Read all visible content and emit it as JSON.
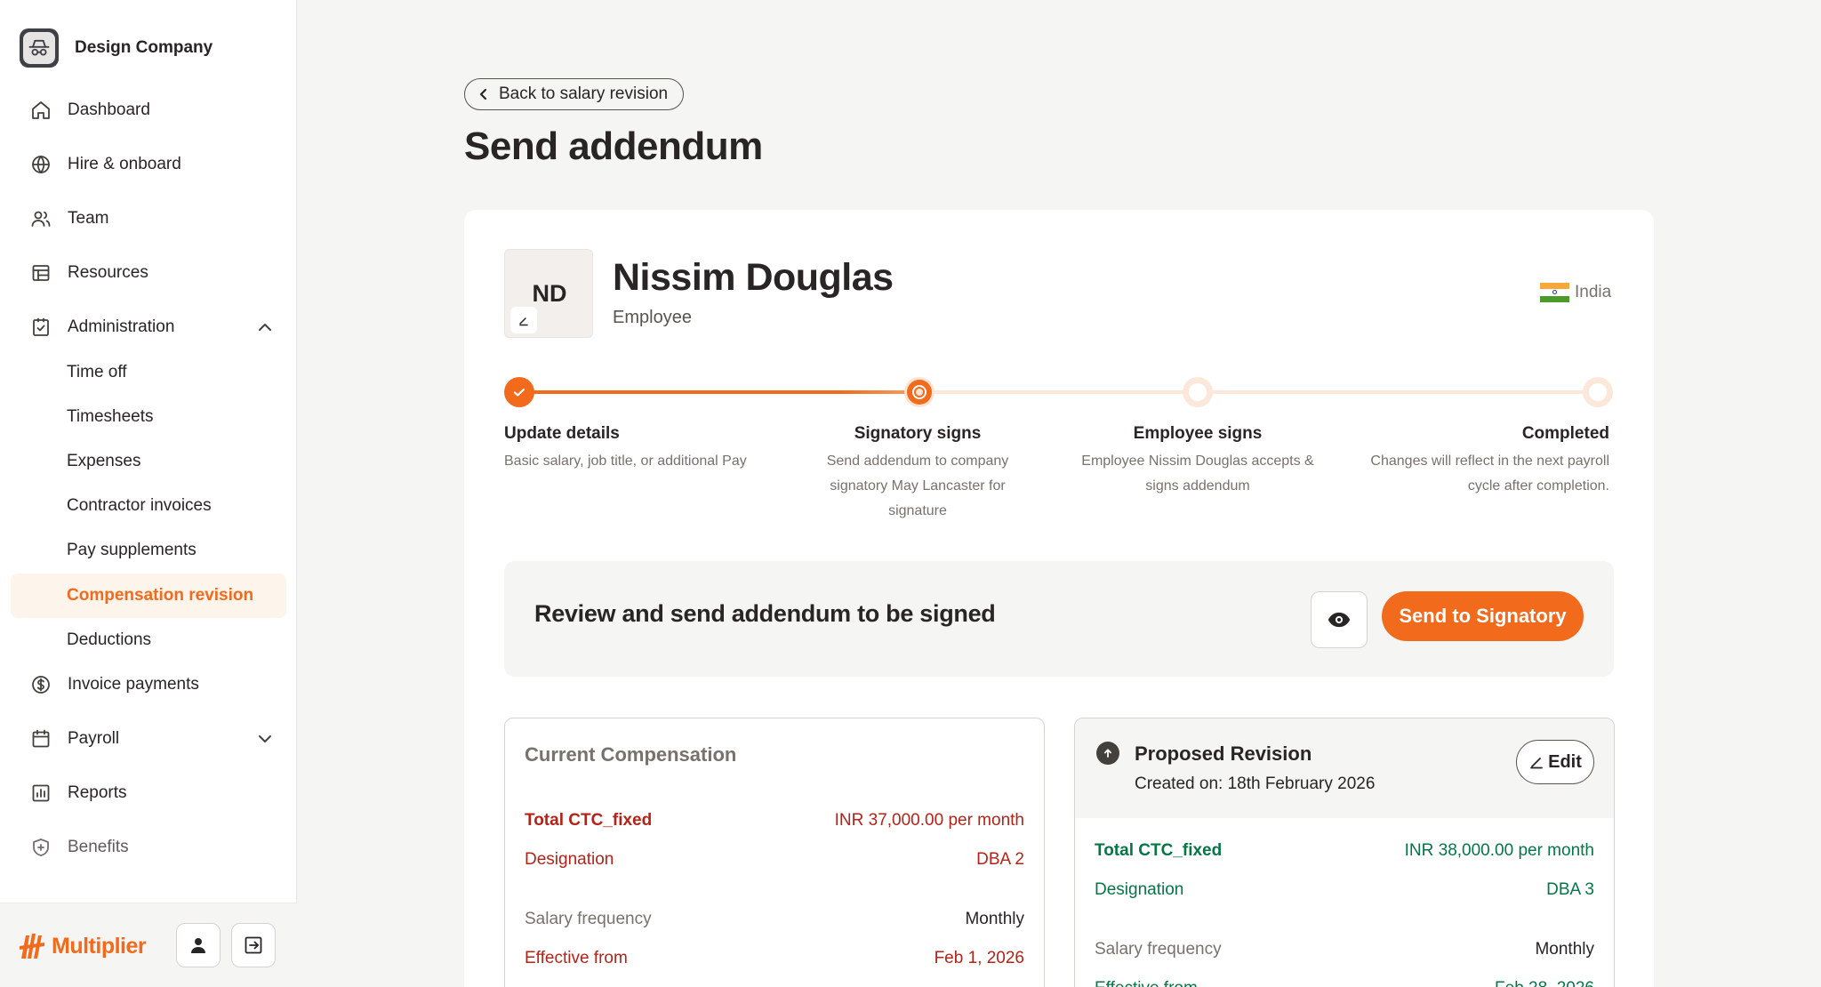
{
  "company": {
    "name": "Design Company"
  },
  "sidebar": {
    "items": [
      {
        "label": "Dashboard"
      },
      {
        "label": "Hire & onboard"
      },
      {
        "label": "Team"
      },
      {
        "label": "Resources"
      },
      {
        "label": "Administration"
      },
      {
        "label": "Invoice payments"
      },
      {
        "label": "Payroll"
      },
      {
        "label": "Reports"
      },
      {
        "label": "Benefits"
      }
    ],
    "admin_sub": [
      {
        "label": "Time off"
      },
      {
        "label": "Timesheets"
      },
      {
        "label": "Expenses"
      },
      {
        "label": "Contractor invoices"
      },
      {
        "label": "Pay supplements"
      },
      {
        "label": "Compensation revision"
      },
      {
        "label": "Deductions"
      }
    ],
    "footer": {
      "brand": "Multiplier"
    }
  },
  "header": {
    "back_label": "Back to salary revision",
    "title": "Send addendum"
  },
  "employee": {
    "initials": "ND",
    "name": "Nissim Douglas",
    "role": "Employee",
    "country": "India"
  },
  "stepper": {
    "steps": [
      {
        "title": "Update details",
        "desc": "Basic salary, job title, or additional Pay",
        "status": "complete"
      },
      {
        "title": "Signatory signs",
        "desc": "Send addendum to company signatory May Lancaster for signature",
        "status": "current"
      },
      {
        "title": "Employee signs",
        "desc": "Employee Nissim Douglas accepts & signs addendum",
        "status": "pending"
      },
      {
        "title": "Completed",
        "desc": "Changes will reflect in the next payroll cycle after completion.",
        "status": "pending"
      }
    ]
  },
  "review": {
    "text": "Review and send addendum to be signed",
    "send_label": "Send to Signatory"
  },
  "current": {
    "title": "Current Compensation",
    "rows": [
      {
        "label": "Total CTC_fixed",
        "value": "INR 37,000.00 per month"
      },
      {
        "label": "Designation",
        "value": "DBA 2"
      },
      {
        "label": "Salary frequency",
        "value": "Monthly"
      },
      {
        "label": "Effective from",
        "value": "Feb 1, 2026"
      }
    ]
  },
  "proposed": {
    "title": "Proposed Revision",
    "created": "Created on: 18th February 2026",
    "edit_label": "Edit",
    "rows": [
      {
        "label": "Total CTC_fixed",
        "value": "INR 38,000.00 per month"
      },
      {
        "label": "Designation",
        "value": "DBA 3"
      },
      {
        "label": "Salary frequency",
        "value": "Monthly"
      },
      {
        "label": "Effective from",
        "value": "Feb 28, 2026"
      }
    ]
  },
  "colors": {
    "accent": "#f26a1b",
    "decrease": "#b42318",
    "increase": "#067647"
  }
}
